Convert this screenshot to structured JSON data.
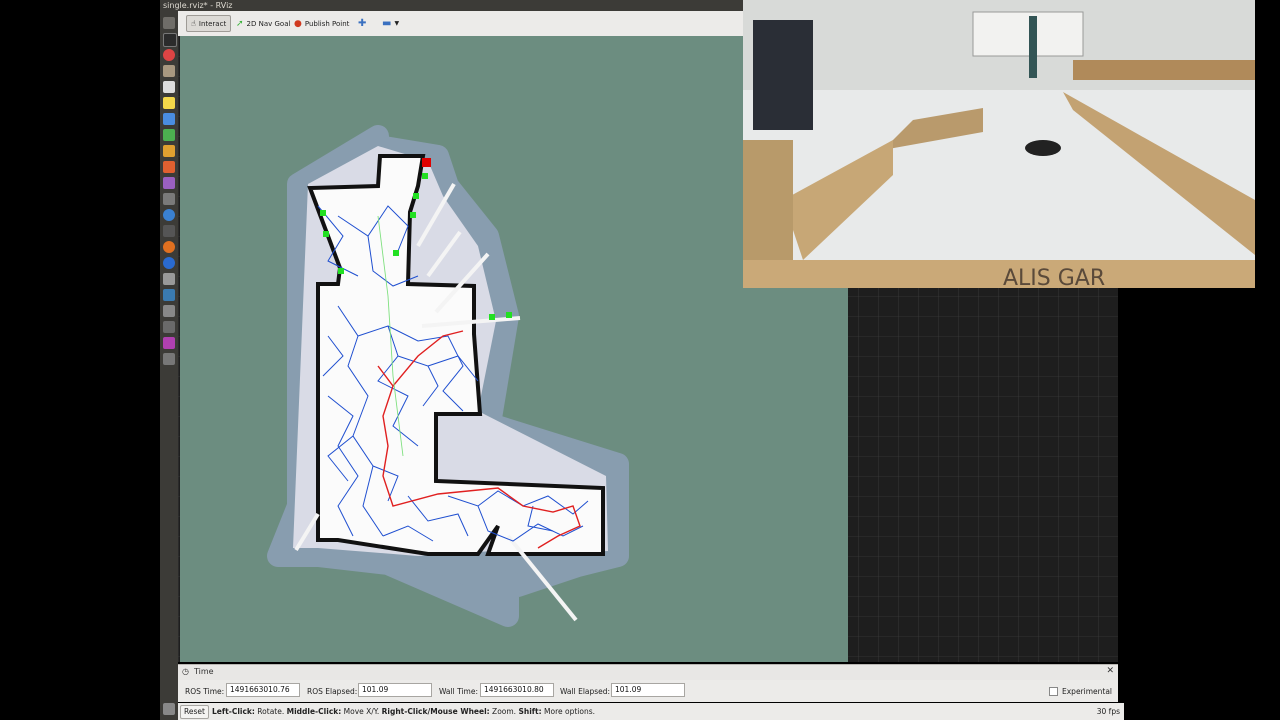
{
  "window": {
    "title": "single.rviz* - RViz"
  },
  "toolbar": {
    "interact": "Interact",
    "nav_goal": "2D Nav Goal",
    "publish_point": "Publish Point"
  },
  "time_panel": {
    "title": "Time",
    "ros_time_label": "ROS Time:",
    "ros_time": "1491663010.76",
    "ros_elapsed_label": "ROS Elapsed:",
    "ros_elapsed": "101.09",
    "wall_time_label": "Wall Time:",
    "wall_time": "1491663010.80",
    "wall_elapsed_label": "Wall Elapsed:",
    "wall_elapsed": "101.09",
    "experimental": "Experimental"
  },
  "status_bar": {
    "reset": "Reset",
    "hint_left": "Left-Click:",
    "hint_left_action": " Rotate. ",
    "hint_middle": "Middle-Click:",
    "hint_middle_action": " Move X/Y. ",
    "hint_right": "Right-Click/Mouse Wheel:",
    "hint_right_action": " Zoom. ",
    "hint_shift": "Shift:",
    "hint_shift_action": " More options.",
    "fps": "30 fps"
  },
  "camera": {
    "sign_text": "ALIS GAR"
  },
  "colors": {
    "map_background": "#6c8d80",
    "rrt_tree": "#1f4fd0",
    "path": "#e02020",
    "frontier": "#22e022",
    "robot": "#e00000"
  }
}
